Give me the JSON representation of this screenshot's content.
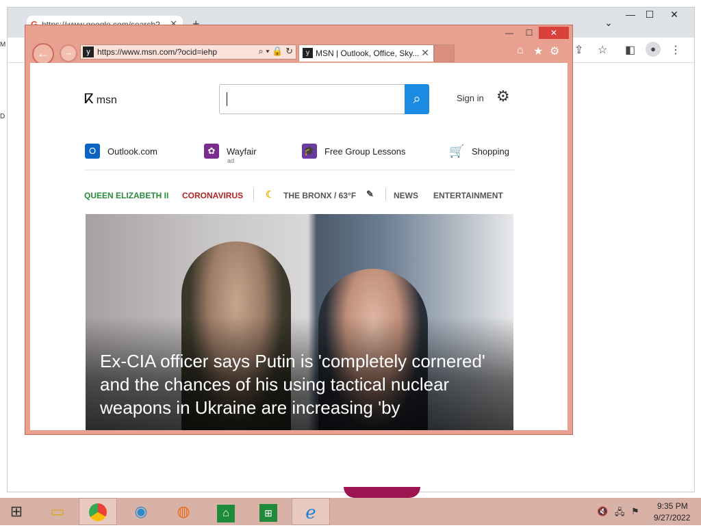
{
  "chrome": {
    "tab_title": "https://www.google.com/search?",
    "tab_close": "✕",
    "new_tab": "+",
    "caption": {
      "minimize": "—",
      "maximize": "☐",
      "close": "✕"
    },
    "dropdown": "⌄"
  },
  "ie": {
    "caption": {
      "minimize": "—",
      "maximize": "☐",
      "close": "✕"
    },
    "address_url": "https://www.msn.com/?ocid=iehp",
    "address_tools": "⌕ ▾ 🔒 ↻",
    "tab_title": "MSN | Outlook, Office, Sky...",
    "tab_close": "✕",
    "favicon": "y"
  },
  "msn": {
    "logo_text": "msn",
    "search_placeholder": "",
    "sign_in": "Sign in",
    "quick_links": [
      {
        "label": "Outlook.com",
        "ad": ""
      },
      {
        "label": "Wayfair",
        "ad": "ad"
      },
      {
        "label": "Free Group Lessons",
        "ad": ""
      },
      {
        "label": "Shopping",
        "ad": ""
      }
    ],
    "nav": {
      "queen": "QUEEN ELIZABETH II",
      "coronavirus": "CORONAVIRUS",
      "weather": "THE BRONX / 63°F",
      "news": "NEWS",
      "entertainment": "ENTERTAINMENT"
    },
    "headline": "Ex-CIA officer says Putin is 'completely cornered' and the chances of his using tactical nuclear weapons in Ukraine are increasing 'by"
  },
  "taskbar": {
    "time": "9:35 PM",
    "date": "9/27/2022"
  },
  "colors": {
    "ie_frame": "#e8a090",
    "msn_blue": "#1a8be0",
    "queen_green": "#2a8a3c",
    "coronavirus_red": "#b22222",
    "taskbar": "#d9b2a7"
  }
}
